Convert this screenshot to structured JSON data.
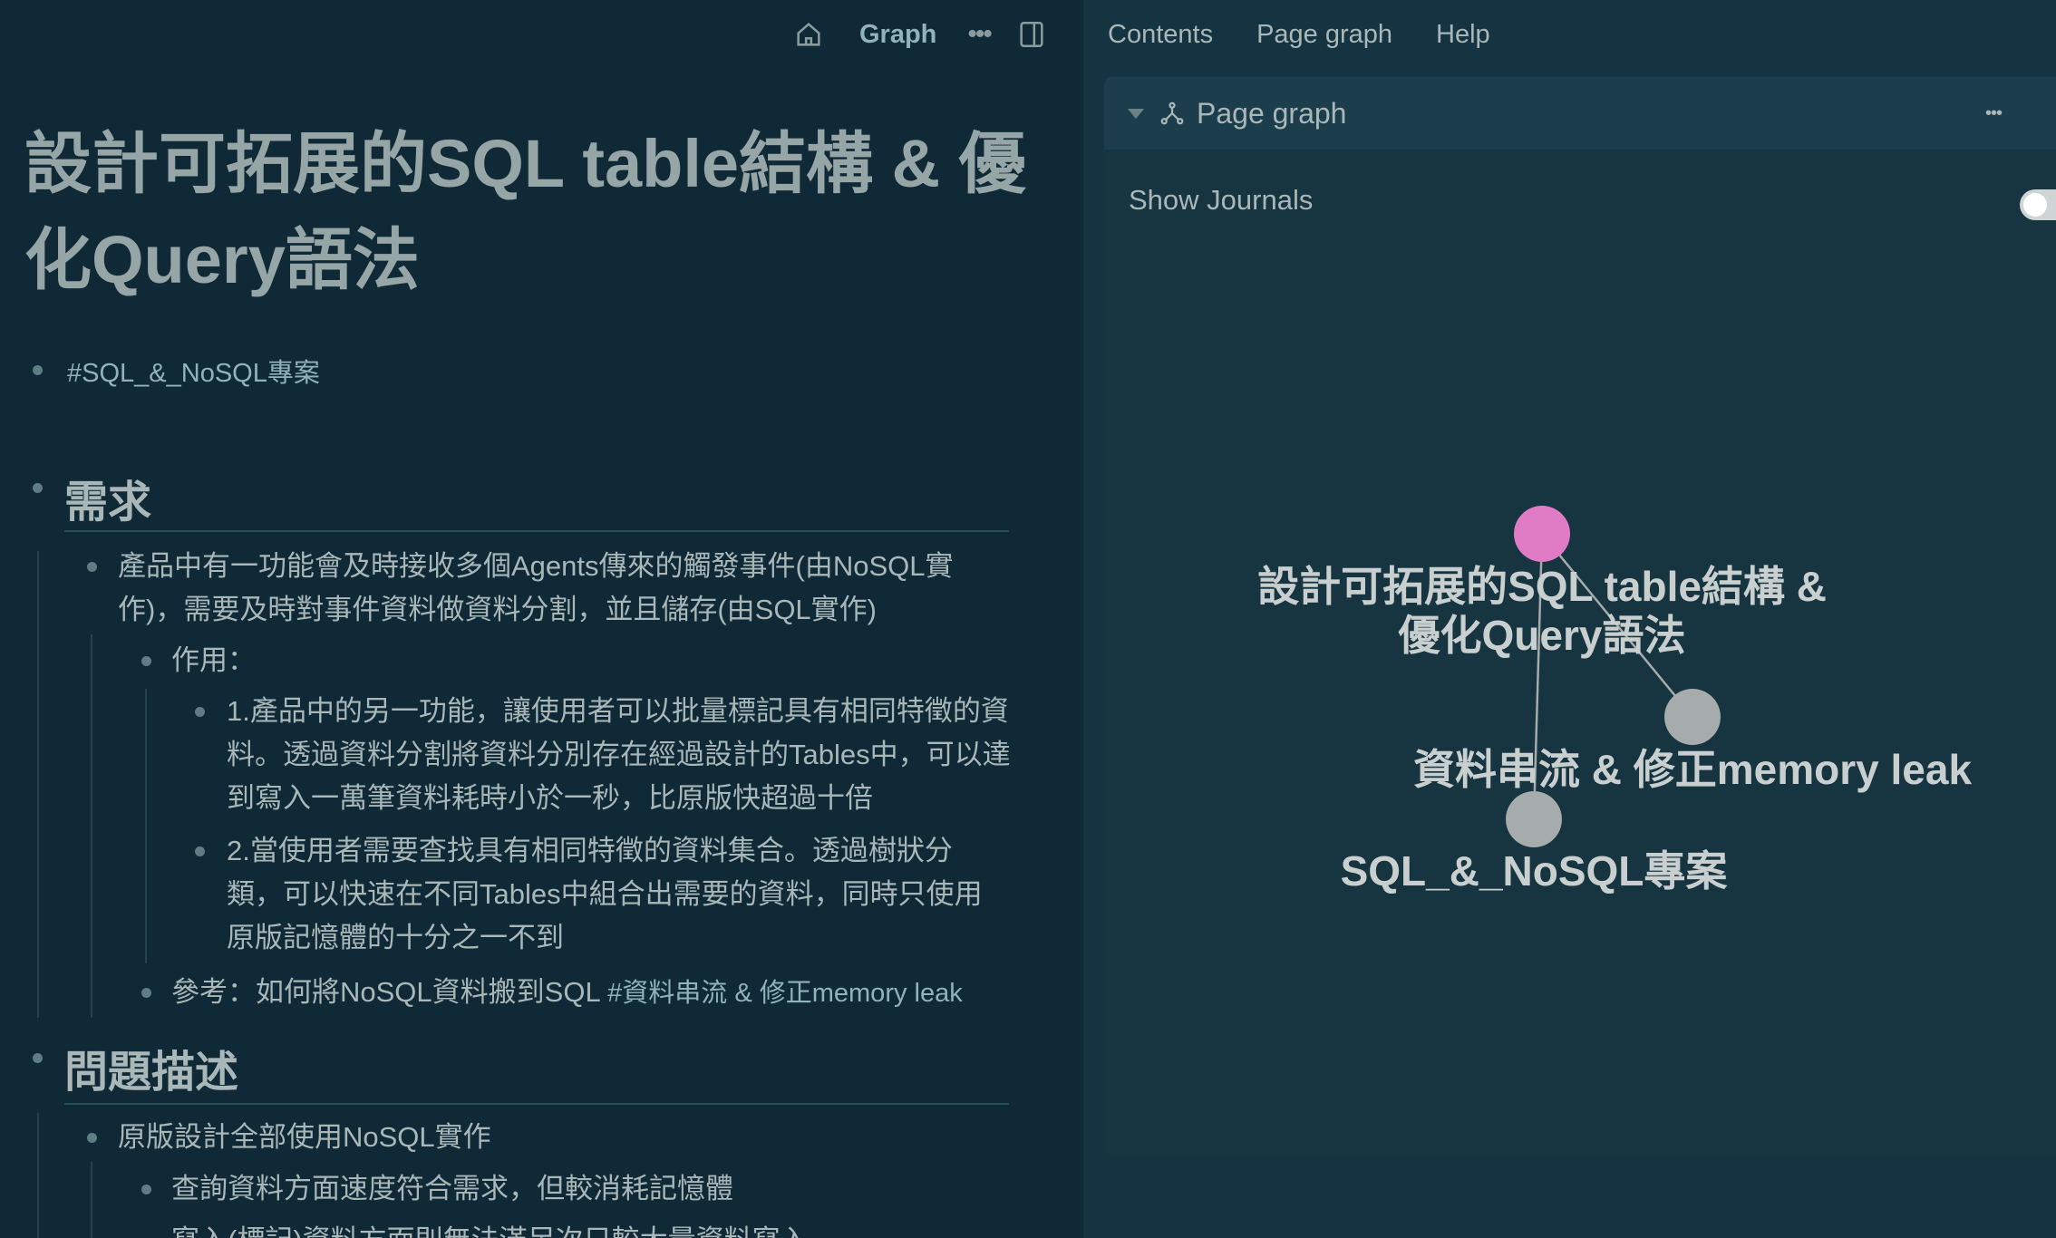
{
  "toolbar": {
    "graph_label": "Graph",
    "home_icon": "home-icon",
    "more_icon": "more-horizontal-icon",
    "sidebar_icon": "toggle-right-sidebar-icon"
  },
  "page": {
    "title": "設計可拓展的SQL table結構 & 優化Query語法",
    "tag": "#SQL_&_NoSQL專案",
    "sections": [
      {
        "heading": "需求"
      },
      {
        "heading": "問題描述"
      }
    ],
    "blocks": {
      "b1": "產品中有一功能會及時接收多個Agents傳來的觸發事件(由NoSQL實作)，需要及時對事件資料做資料分割，並且儲存(由SQL實作)",
      "b2": "作用：",
      "b3": "1.產品中的另一功能，讓使用者可以批量標記具有相同特徵的資料。透過資料分割將資料分別存在經過設計的Tables中，可以達到寫入一萬筆資料耗時小於一秒，比原版快超過十倍",
      "b4": "2.當使用者需要查找具有相同特徵的資料集合。透過樹狀分類，可以快速在不同Tables中組合出需要的資料，同時只使用原版記憶體的十分之一不到",
      "b5_text": "參考：如何將NoSQL資料搬到SQL ",
      "b5_tag": "#資料串流 & 修正memory leak",
      "b6": "原版設計全部使用NoSQL實作",
      "b7": "查詢資料方面速度符合需求，但較消耗記憶體",
      "b8": "寫入(標記)資料方面則無法滿足次只較大量資料寫入"
    }
  },
  "sidebar": {
    "tabs": [
      "Contents",
      "Page graph",
      "Help"
    ],
    "panel": {
      "title": "Page graph",
      "icon": "graph-branch-icon",
      "more_icon": "more-horizontal-icon",
      "show_journals_label": "Show Journals",
      "show_journals_on": false
    },
    "graph": {
      "nodes": [
        {
          "id": "current",
          "label": "設計可拓展的SQL table結構 & 優化Query語法",
          "color": "#e07bc6"
        },
        {
          "id": "stream",
          "label": "資料串流 & 修正memory leak",
          "color": "#a6abab"
        },
        {
          "id": "project",
          "label": "SQL_&_NoSQL專案",
          "color": "#a6abab"
        }
      ],
      "edges": [
        {
          "from": "current",
          "to": "stream"
        },
        {
          "from": "current",
          "to": "project"
        }
      ]
    }
  }
}
